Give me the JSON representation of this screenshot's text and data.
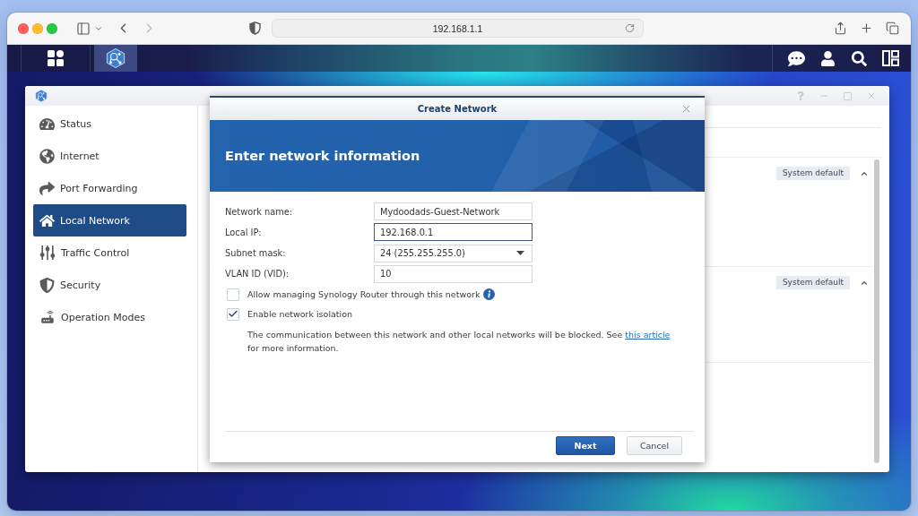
{
  "browser": {
    "navigation": [
      {
        "kind": "back",
        "disabled": false
      },
      {
        "kind": "forward",
        "disabled": true
      }
    ],
    "address": "192.168.1.1"
  },
  "taskbar": {
    "apps": [
      {
        "kind": "network-center",
        "selected": true
      }
    ]
  },
  "window": {
    "sidebar": {
      "items": [
        {
          "kind": "status",
          "label": "Status",
          "selected": false
        },
        {
          "kind": "internet",
          "label": "Internet",
          "selected": false
        },
        {
          "kind": "port-forwarding",
          "label": "Port Forwarding",
          "selected": false
        },
        {
          "kind": "local-network",
          "label": "Local Network",
          "selected": true
        },
        {
          "kind": "traffic-control",
          "label": "Traffic Control",
          "selected": false
        },
        {
          "kind": "security",
          "label": "Security",
          "selected": false
        },
        {
          "kind": "operation-modes",
          "label": "Operation Modes",
          "selected": false
        }
      ]
    },
    "rows": [
      {
        "tag": "System default",
        "expanded": true
      },
      {
        "tag": "System default",
        "expanded": true
      }
    ]
  },
  "dialog": {
    "title": "Create Network",
    "heading": "Enter network information",
    "fields": [
      {
        "kind": "text",
        "label": "Network name:",
        "value": "Mydoodads-Guest-Network",
        "focused": false
      },
      {
        "kind": "text",
        "label": "Local IP:",
        "value": "192.168.0.1",
        "focused": true
      },
      {
        "kind": "select",
        "label": "Subnet mask:",
        "value": "24 (255.255.255.0)",
        "focused": false
      },
      {
        "kind": "text",
        "label": "VLAN ID (VID):",
        "value": "10",
        "focused": false
      }
    ],
    "options": [
      {
        "label": "Allow managing Synology Router through this network",
        "checked": false,
        "info": true
      },
      {
        "label": "Enable network isolation",
        "checked": true
      }
    ],
    "note": {
      "text": "The communication between this network and other local networks will be blocked. See",
      "link": "this article",
      "after": "for more information."
    },
    "buttons": [
      {
        "kind": "primary",
        "label": "Next"
      },
      {
        "kind": "secondary",
        "label": "Cancel"
      }
    ]
  }
}
